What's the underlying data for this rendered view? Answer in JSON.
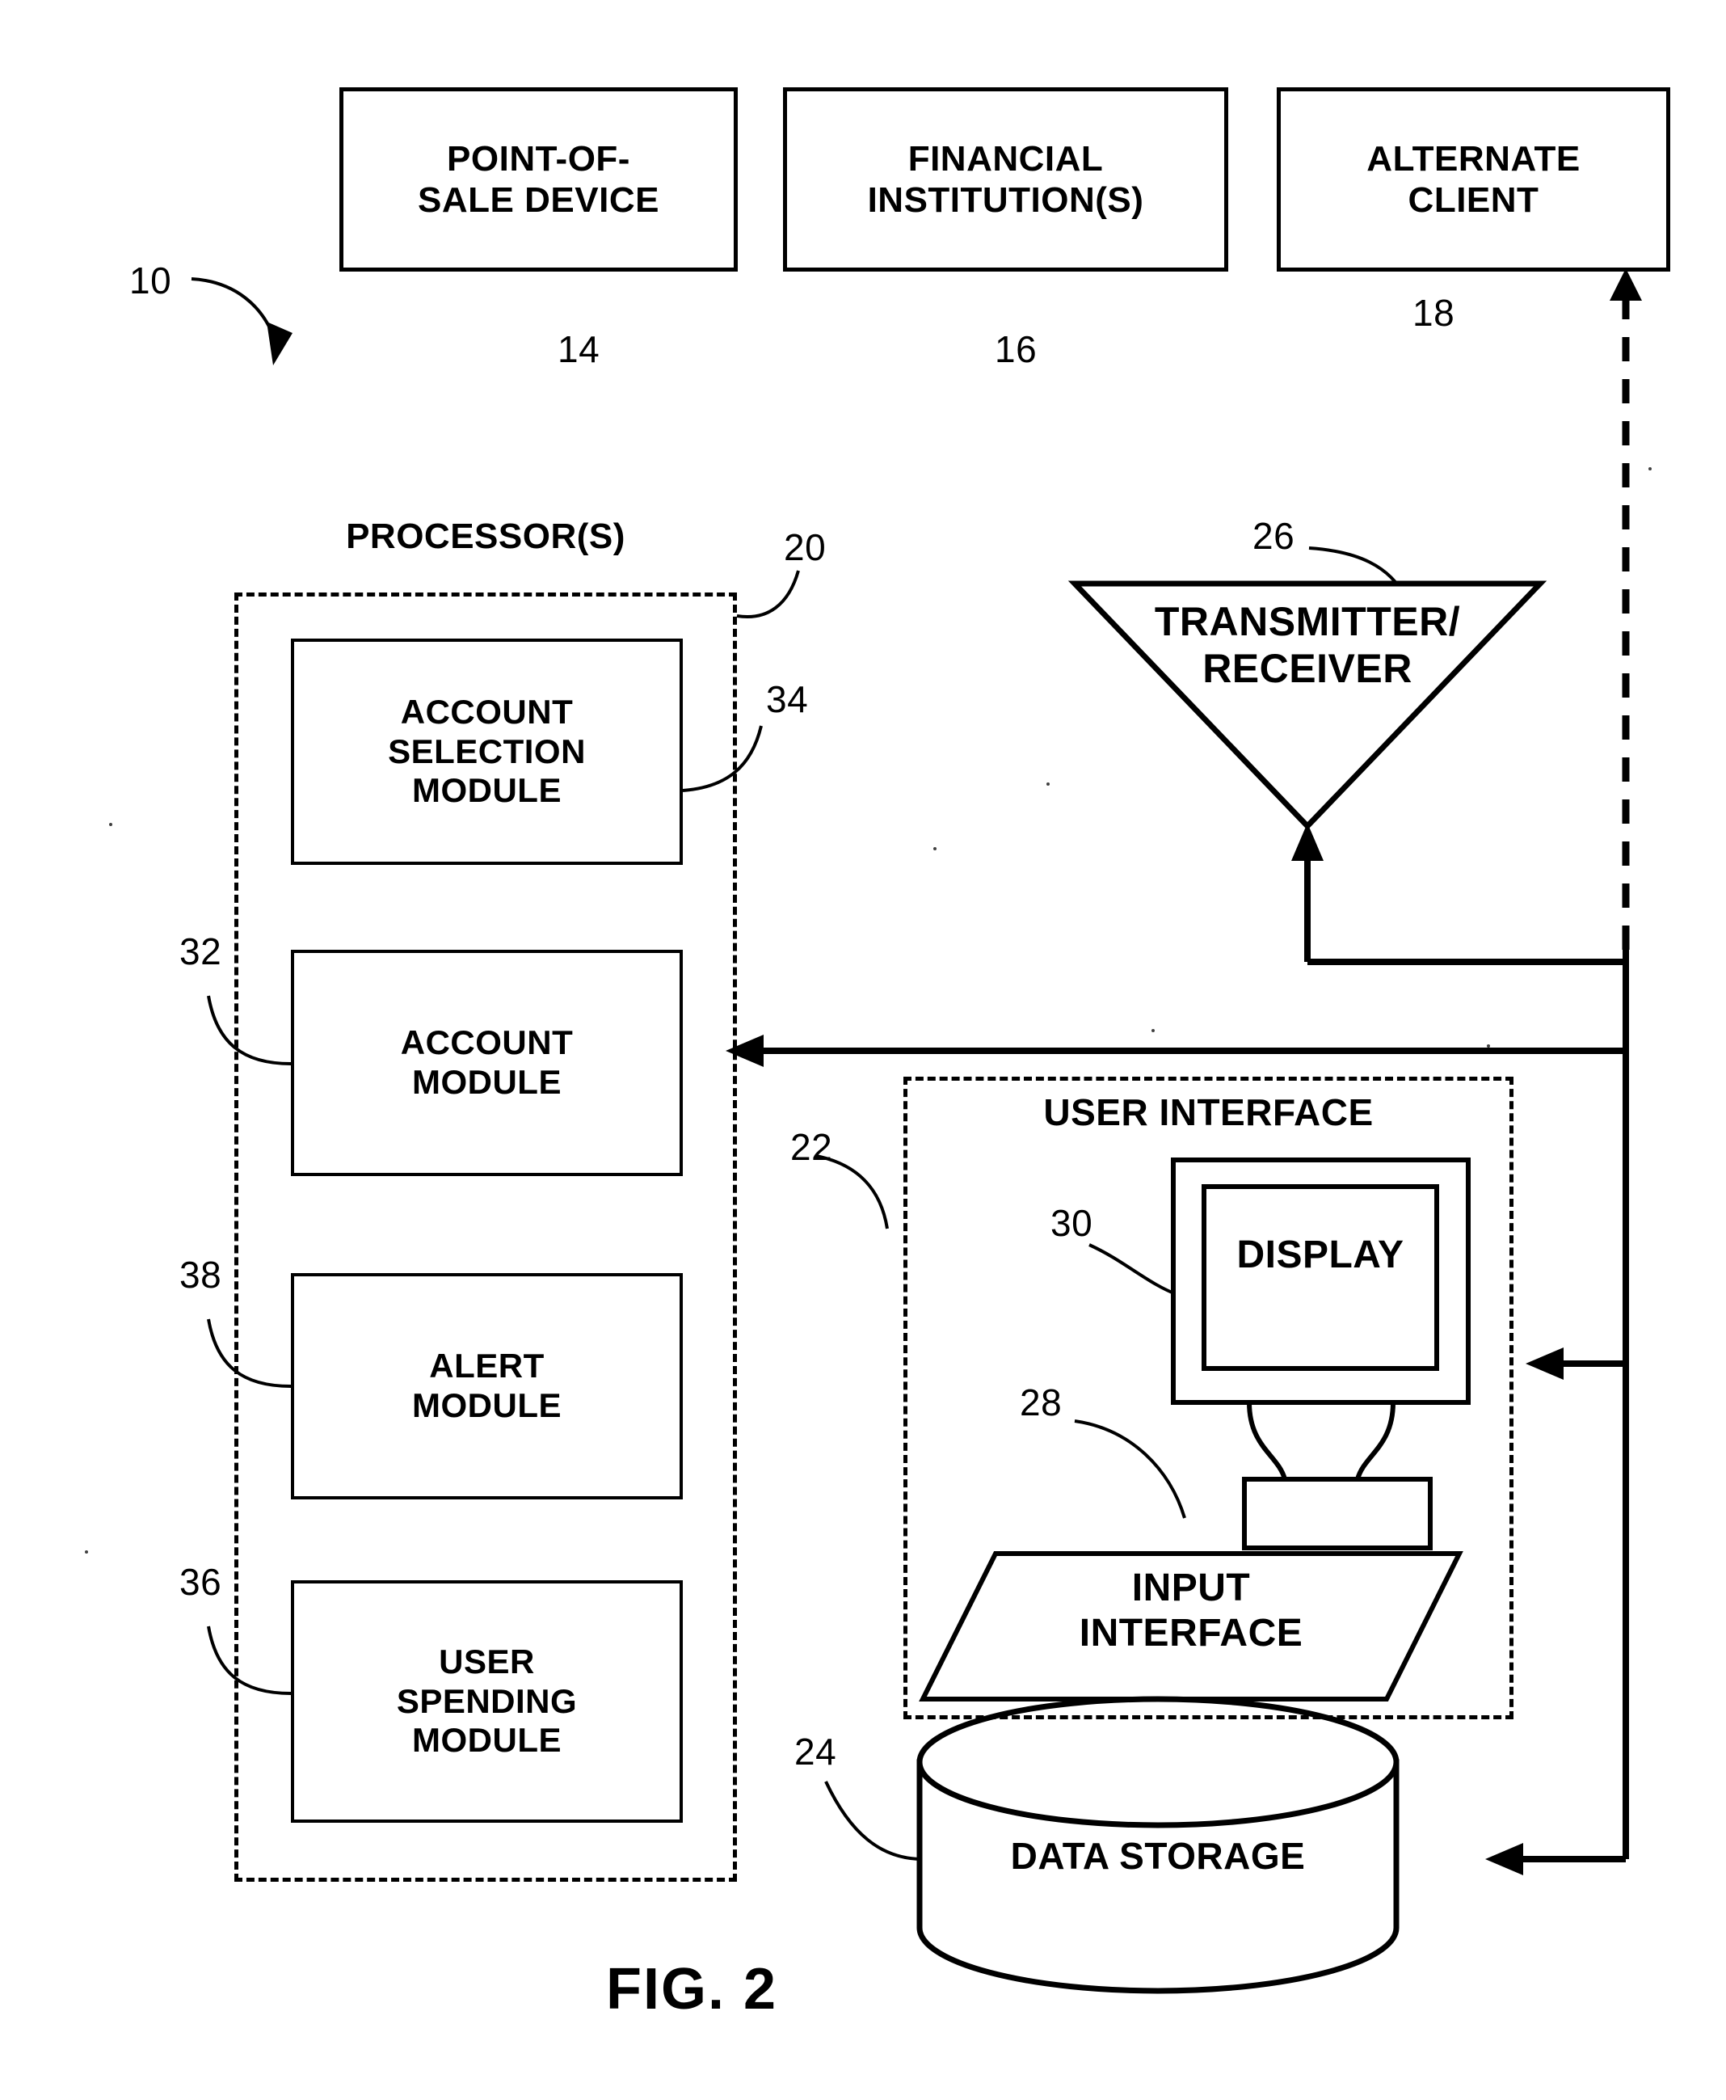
{
  "figure": {
    "caption": "FIG. 2",
    "system_ref": "10"
  },
  "top_blocks": [
    {
      "label": "POINT-OF-\nSALE DEVICE",
      "ref": "14"
    },
    {
      "label": "FINANCIAL\nINSTITUTION(S)",
      "ref": "16"
    },
    {
      "label": "ALTERNATE\nCLIENT",
      "ref": "18"
    }
  ],
  "processor": {
    "title": "PROCESSOR(S)",
    "ref": "20",
    "modules": [
      {
        "label": "ACCOUNT\nSELECTION\nMODULE",
        "ref": "34"
      },
      {
        "label": "ACCOUNT\nMODULE",
        "ref": "32"
      },
      {
        "label": "ALERT\nMODULE",
        "ref": "38"
      },
      {
        "label": "USER\nSPENDING\nMODULE",
        "ref": "36"
      }
    ]
  },
  "transceiver": {
    "label": "TRANSMITTER/\nRECEIVER",
    "ref": "26"
  },
  "user_interface": {
    "title": "USER INTERFACE",
    "ref": "22",
    "display": {
      "label": "DISPLAY",
      "ref": "30"
    },
    "input": {
      "label": "INPUT\nINTERFACE",
      "ref": "28"
    }
  },
  "data_storage": {
    "label": "DATA STORAGE",
    "ref": "24"
  },
  "colors": {
    "ink": "#000000",
    "paper": "#ffffff"
  }
}
